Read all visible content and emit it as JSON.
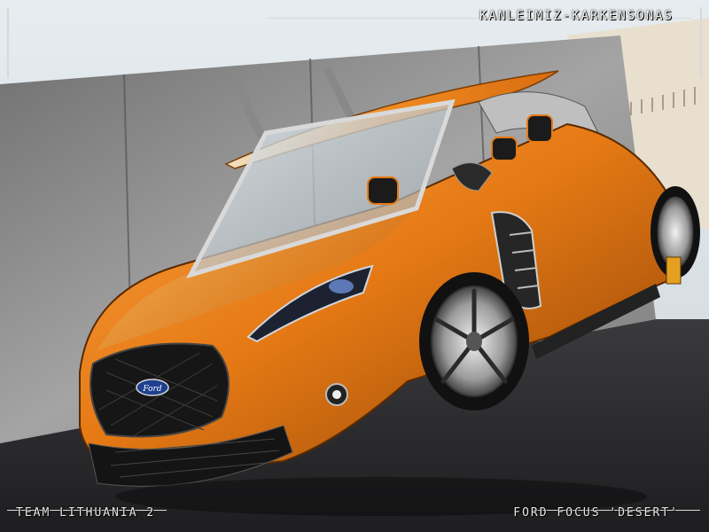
{
  "captions": {
    "artist": "Kanleimiz-Karkensonas",
    "team": "Team Lithuania 2",
    "title": "Ford Focus 'Desert'"
  },
  "badge": {
    "brand": "Ford"
  },
  "colors": {
    "body": "#e67a15",
    "body_dark": "#8a3f05",
    "wall": "#8a8a8a",
    "road": "#2e2e30",
    "sky": "#dfe7ec"
  }
}
